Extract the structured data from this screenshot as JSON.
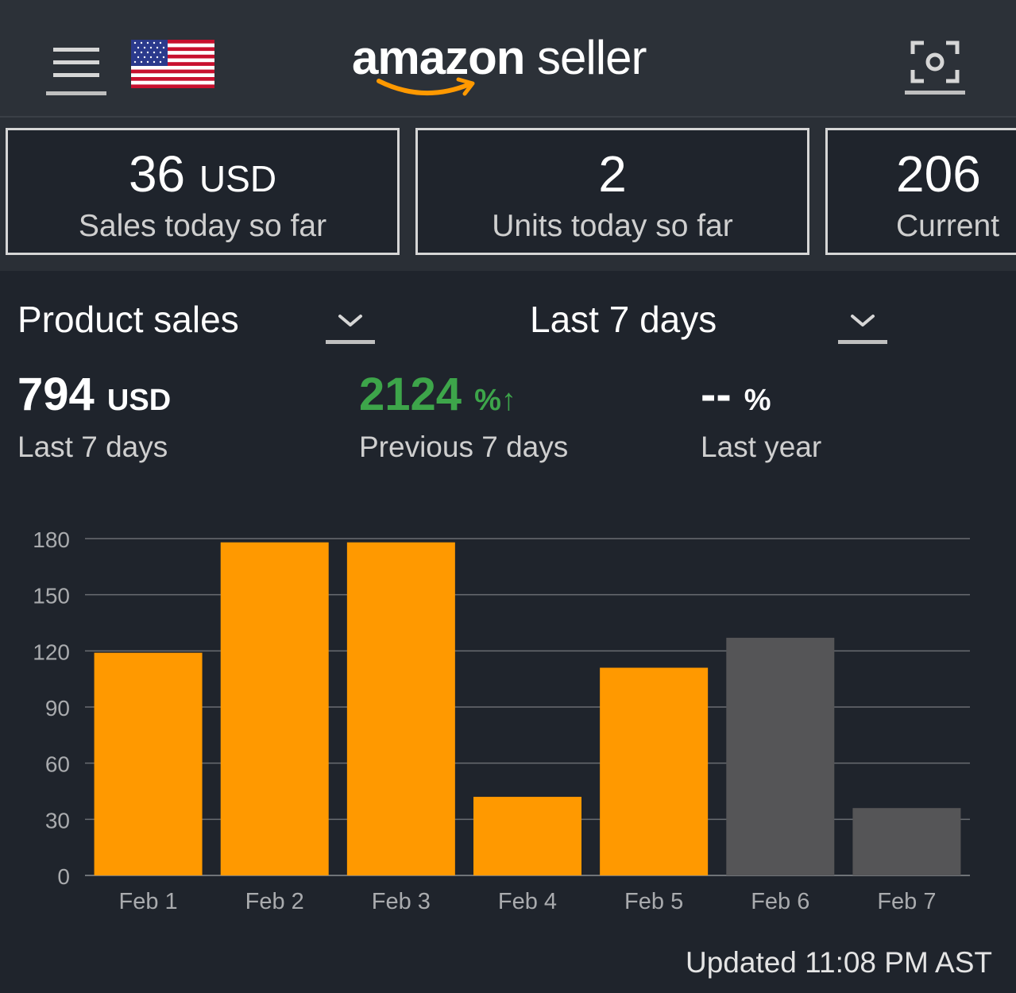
{
  "header": {
    "logo_word_bold": "amazon",
    "logo_word": " seller",
    "menu_icon": "hamburger-menu-icon",
    "flag_icon": "us-flag-icon",
    "scan_icon": "camera-scan-icon"
  },
  "cards": [
    {
      "value": "36",
      "unit": "USD",
      "label": "Sales today so far"
    },
    {
      "value": "2",
      "unit": "",
      "label": "Units today so far"
    },
    {
      "value": "206",
      "unit": "",
      "label": "Current"
    }
  ],
  "selectors": {
    "metric": "Product sales",
    "range": "Last 7 days"
  },
  "stats": [
    {
      "value": "794",
      "unit": "USD",
      "label": "Last 7 days",
      "arrow": ""
    },
    {
      "value": "2124",
      "unit": "%",
      "label": "Previous 7 days",
      "arrow": "↑"
    },
    {
      "value": "--",
      "unit": "%",
      "label": "Last year",
      "arrow": ""
    }
  ],
  "chart_data": {
    "type": "bar",
    "categories": [
      "Feb 1",
      "Feb 2",
      "Feb 3",
      "Feb 4",
      "Feb 5",
      "Feb 6",
      "Feb 7"
    ],
    "values": [
      119,
      178,
      178,
      42,
      111,
      127,
      36
    ],
    "bar_colors": [
      "#ff9900",
      "#ff9900",
      "#ff9900",
      "#ff9900",
      "#ff9900",
      "#555557",
      "#555557"
    ],
    "yticks": [
      0,
      30,
      60,
      90,
      120,
      150,
      180
    ],
    "ylim": [
      0,
      180
    ],
    "grid": true,
    "title": "",
    "xlabel": "",
    "ylabel": ""
  },
  "footer": {
    "updated": "Updated 11:08 PM AST"
  },
  "colors": {
    "accent": "#ff9900",
    "positive": "#3da54a",
    "background": "#1f242c",
    "header": "#2c3138"
  }
}
